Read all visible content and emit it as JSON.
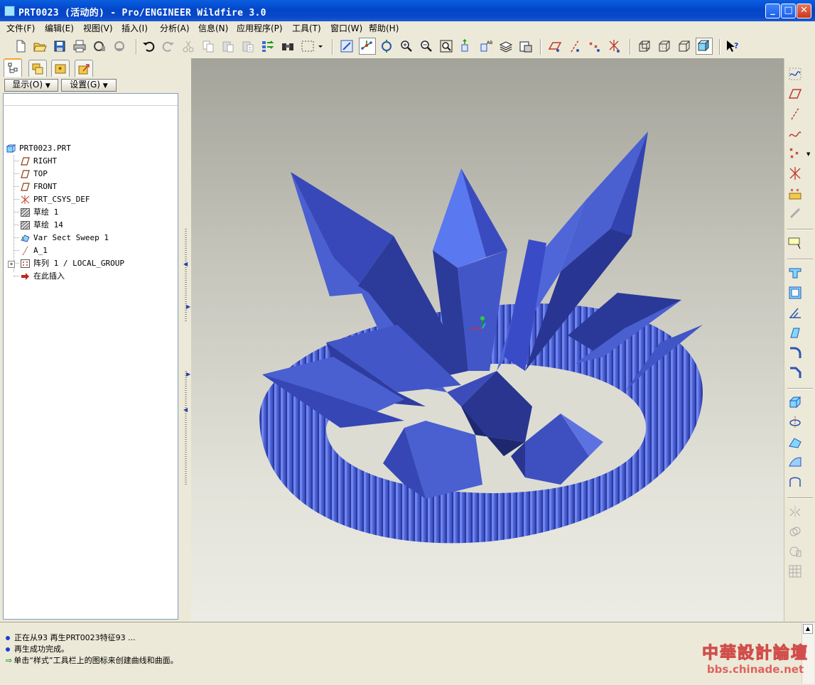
{
  "window": {
    "title": "PRT0023 (活动的) - Pro/ENGINEER Wildfire 3.0",
    "controls": [
      "minimize",
      "maximize",
      "close"
    ]
  },
  "menu": [
    "文件(F)",
    "编辑(E)",
    "视图(V)",
    "插入(I)",
    "分析(A)",
    "信息(N)",
    "应用程序(P)",
    "工具(T)",
    "窗口(W)",
    "帮助(H)"
  ],
  "toolbar": {
    "icons": [
      "new-icon",
      "open-icon",
      "save-icon",
      "print-icon",
      "send-mail-icon",
      "send-link-icon",
      "undo-icon",
      "redo-icon",
      "cut-icon",
      "copy-icon",
      "paste-icon",
      "paste-special-icon",
      "regenerate-icon",
      "find-icon",
      "selection-filter-icon",
      "redraw-icon",
      "spin-center-icon",
      "orient-mode-icon",
      "zoom-in-icon",
      "zoom-out-icon",
      "refit-icon",
      "reorient-icon",
      "saved-views-icon",
      "layers-icon",
      "view-manager-icon",
      "datum-planes-icon",
      "datum-axes-icon",
      "datum-points-icon",
      "coordinate-systems-icon",
      "wireframe-icon",
      "hidden-line-icon",
      "no-hidden-icon",
      "shading-icon",
      "context-help-icon"
    ]
  },
  "left_panel": {
    "tabs": [
      "model-tree-tab",
      "layers-tab",
      "favorites-tab",
      "connections-tab"
    ],
    "show_button": "显示(O)",
    "settings_button": "设置(G)",
    "tree": [
      {
        "label": "PRT0023.PRT",
        "icon": "part-icon",
        "level": 0
      },
      {
        "label": "RIGHT",
        "icon": "datum-plane-icon",
        "level": 1
      },
      {
        "label": "TOP",
        "icon": "datum-plane-icon",
        "level": 1
      },
      {
        "label": "FRONT",
        "icon": "datum-plane-icon",
        "level": 1
      },
      {
        "label": "PRT_CSYS_DEF",
        "icon": "csys-icon",
        "level": 1
      },
      {
        "label": "草绘 1",
        "icon": "sketch-icon",
        "level": 1
      },
      {
        "label": "草绘 14",
        "icon": "sketch-icon",
        "level": 1
      },
      {
        "label": "Var Sect Sweep 1",
        "icon": "sweep-icon",
        "level": 1
      },
      {
        "label": "A_1",
        "icon": "axis-icon",
        "level": 1
      },
      {
        "label": "阵列 1 / LOCAL_GROUP",
        "icon": "pattern-icon",
        "level": 1,
        "expandable": true
      },
      {
        "label": "在此插入",
        "icon": "insert-here-icon",
        "level": 1
      }
    ]
  },
  "right_toolbar": {
    "icons": [
      "datum-curve-icon",
      "datum-plane-tool-icon",
      "datum-axis-tool-icon",
      "sketched-curve-icon",
      "datum-point-tool-icon",
      "coordinate-system-tool-icon",
      "analysis-feature-icon",
      "sketch-tool-icon",
      "note-icon",
      "hole-icon",
      "shell-icon",
      "rib-icon",
      "draft-icon",
      "round-icon",
      "chamfer-icon",
      "extrude-icon",
      "revolve-icon",
      "variable-sweep-icon",
      "boundary-blend-icon",
      "style-icon",
      "mirror-icon",
      "merge-icon",
      "trim-icon",
      "pattern-tool-icon"
    ]
  },
  "messages": [
    {
      "type": "info",
      "text": "正在从93 再生PRT0023特征93 ..."
    },
    {
      "type": "info",
      "text": "再生成功完成。"
    },
    {
      "type": "prompt",
      "text": "单击“样式”工具栏上的图标来创建曲线和曲面。"
    }
  ],
  "watermark": {
    "line1": "中華設計論壇",
    "line2": "bbs.chinade.net"
  },
  "colors": {
    "model": "#4a5fd0",
    "titlebar": "#0a4fd6",
    "background_top": "#a3a39a",
    "background_bottom": "#ecece4"
  }
}
